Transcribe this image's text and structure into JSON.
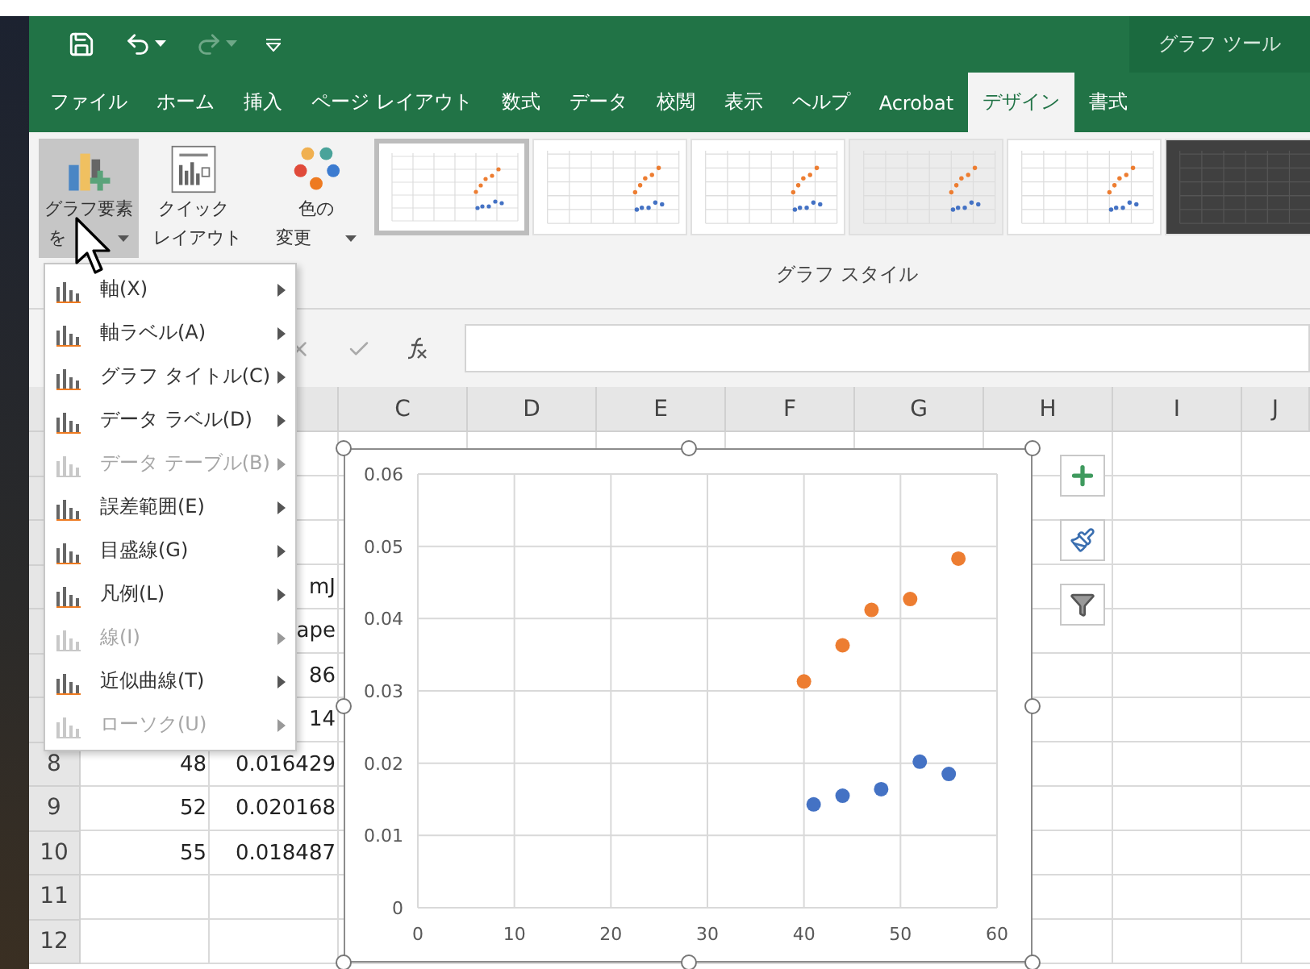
{
  "title_bar": {
    "quick_access": [
      {
        "kind": "save",
        "disabled": false
      },
      {
        "kind": "undo",
        "disabled": false
      },
      {
        "kind": "redo",
        "disabled": true
      },
      {
        "kind": "customize",
        "disabled": false
      }
    ],
    "context_title": "グラフ ツール"
  },
  "tabs": [
    {
      "label": "ファイル",
      "selected": false
    },
    {
      "label": "ホーム",
      "selected": false
    },
    {
      "label": "挿入",
      "selected": false
    },
    {
      "label": "ページ レイアウト",
      "selected": false
    },
    {
      "label": "数式",
      "selected": false
    },
    {
      "label": "データ",
      "selected": false
    },
    {
      "label": "校閲",
      "selected": false
    },
    {
      "label": "表示",
      "selected": false
    },
    {
      "label": "ヘルプ",
      "selected": false
    },
    {
      "label": "Acrobat",
      "selected": false
    },
    {
      "label": "デザイン",
      "selected": true
    },
    {
      "label": "書式",
      "selected": false
    }
  ],
  "ribbon": {
    "buttons": [
      {
        "kind": "add-element",
        "lines": [
          "グラフ要素",
          "を"
        ],
        "expanded": true
      },
      {
        "kind": "quick-layout",
        "lines": [
          "クイック",
          "レイアウト"
        ],
        "expanded": false
      },
      {
        "kind": "colors",
        "lines": [
          "色の",
          "変更"
        ],
        "expanded": false
      }
    ],
    "gallery": {
      "label": "グラフ スタイル",
      "styles": [
        {
          "kind": "light",
          "selected": true
        },
        {
          "kind": "light",
          "selected": false
        },
        {
          "kind": "light",
          "selected": false
        },
        {
          "kind": "gray",
          "selected": false
        },
        {
          "kind": "light",
          "selected": false
        },
        {
          "kind": "dark",
          "selected": false
        }
      ]
    }
  },
  "menu": {
    "items": [
      {
        "label": "軸(X)",
        "disabled": false
      },
      {
        "label": "軸ラベル(A)",
        "disabled": false
      },
      {
        "label": "グラフ タイトル(C)",
        "disabled": false
      },
      {
        "label": "データ ラベル(D)",
        "disabled": false
      },
      {
        "label": "データ テーブル(B)",
        "disabled": true
      },
      {
        "label": "誤差範囲(E)",
        "disabled": false
      },
      {
        "label": "目盛線(G)",
        "disabled": false
      },
      {
        "label": "凡例(L)",
        "disabled": false
      },
      {
        "label": "線(I)",
        "disabled": true
      },
      {
        "label": "近似曲線(T)",
        "disabled": false
      },
      {
        "label": "ローソク(U)",
        "disabled": true
      }
    ]
  },
  "sheet": {
    "column_headers": [
      "C",
      "D",
      "E",
      "F",
      "G",
      "H",
      "I",
      "J"
    ],
    "rows": [
      {},
      {},
      {},
      {
        "b": "mJ"
      },
      {
        "b": "ape"
      },
      {
        "b": "86"
      },
      {
        "b": "14"
      },
      {
        "number": "8",
        "a": "48",
        "b": "0.016429"
      },
      {
        "number": "9",
        "a": "52",
        "b": "0.020168"
      },
      {
        "number": "10",
        "a": "55",
        "b": "0.018487"
      },
      {
        "number": "11"
      },
      {
        "number": "12"
      }
    ]
  },
  "chart": {
    "chart_data": {
      "type": "scatter",
      "xlim": [
        0,
        60
      ],
      "ylim": [
        0,
        0.06
      ],
      "xticks": [
        0,
        10,
        20,
        30,
        40,
        50,
        60
      ],
      "yticks": [
        {
          "value": 0,
          "label": "0"
        },
        {
          "value": 0.01,
          "label": "0.01"
        },
        {
          "value": 0.02,
          "label": "0.02"
        },
        {
          "value": 0.03,
          "label": "0.03"
        },
        {
          "value": 0.04,
          "label": "0.04"
        },
        {
          "value": 0.05,
          "label": "0.05"
        },
        {
          "value": 0.06,
          "label": "0.06"
        }
      ],
      "series": [
        {
          "color": "#ed7d31",
          "x": [
            40,
            44,
            47,
            51,
            56
          ],
          "values": [
            0.0313,
            0.0363,
            0.0412,
            0.0427,
            0.0483
          ]
        },
        {
          "color": "#4472c4",
          "x": [
            41,
            44,
            48,
            52,
            55
          ],
          "values": [
            0.0143,
            0.0155,
            0.0164,
            0.0202,
            0.0185
          ]
        }
      ],
      "grid": true
    }
  }
}
